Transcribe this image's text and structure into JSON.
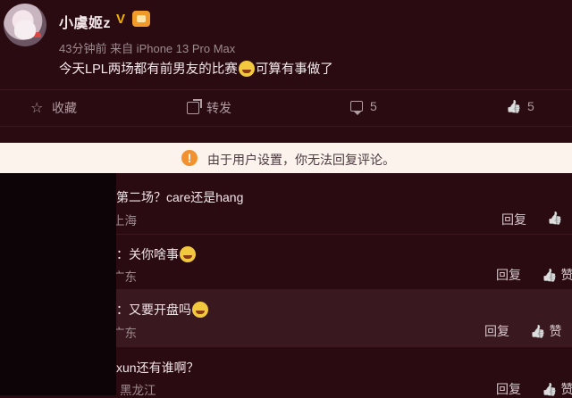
{
  "post": {
    "username": "小虞姬z",
    "verified_badge": "V",
    "meta": "43分钟前  来自 iPhone 13 Pro Max",
    "text_before_emoji": "今天LPL两场都有前男友的比赛",
    "text_after_emoji": "可算有事做了",
    "emoji_name": "crying-laugh"
  },
  "actions": {
    "collect_label": "收藏",
    "share_label": "转发",
    "comment_count": "5",
    "like_count": "5"
  },
  "notice": {
    "text": "由于用户设置，你无法回复评论。",
    "icon": "!"
  },
  "comments": [
    {
      "text": "第二场？care还是hang",
      "location": "上海",
      "reply": "回复"
    },
    {
      "text": "：关你啥事",
      "location": "广东",
      "reply": "回复",
      "like": "赞"
    },
    {
      "text": "：又要开盘吗",
      "location": "广东",
      "reply": "回复",
      "like": "赞"
    },
    {
      "text": "xun还有谁啊？",
      "location": "黑龙江",
      "reply": "回复",
      "like": "赞"
    }
  ],
  "colors": {
    "background": "#2a0b12",
    "highlight_row": "#3a1820",
    "notice_bg": "#fbf3ec",
    "notice_icon": "#f2912f",
    "verified": "#f2b300"
  }
}
